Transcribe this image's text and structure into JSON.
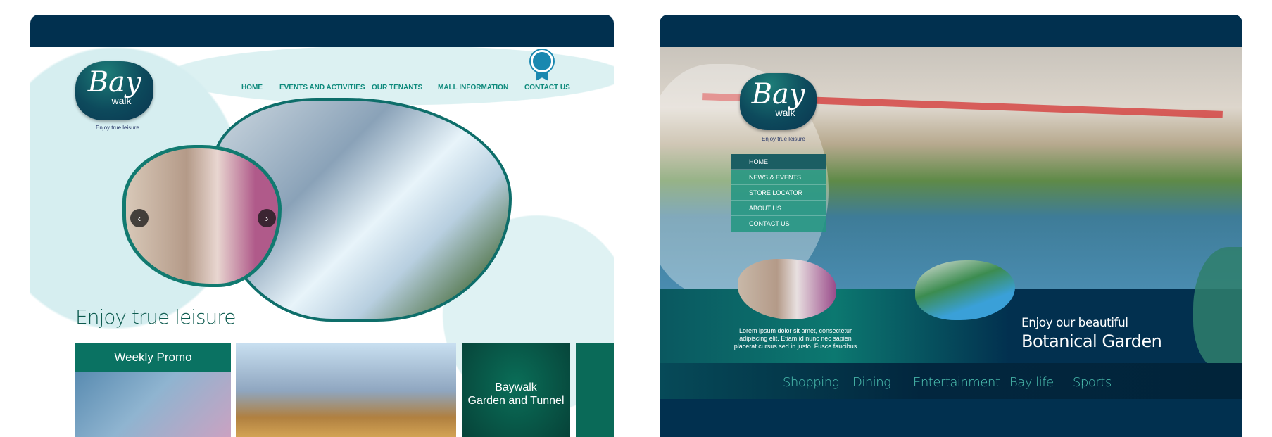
{
  "left_design": {
    "logo": {
      "text": "Bay",
      "subtext": "walk"
    },
    "tagline": "Enjoy true leisure",
    "nav": [
      "HOME",
      "EVENTS  AND  ACTIVITIES",
      "OUR TENANTS",
      "MALL INFORMATION",
      "CONTACT US"
    ],
    "badge_icon": "ribbon-badge-icon",
    "slider": {
      "prev_icon": "chevron-left-icon",
      "next_icon": "chevron-right-icon"
    },
    "heading": "Enjoy true leisure",
    "tiles": {
      "weekly_promo": "Weekly Promo",
      "garden_line1": "Baywalk",
      "garden_line2": "Garden and Tunnel"
    }
  },
  "right_design": {
    "logo": {
      "text": "Bay",
      "subtext": "walk"
    },
    "tagline": "Enjoy true leisure",
    "menu": [
      "HOME",
      "NEWS & EVENTS",
      "STORE LOCATOR",
      "ABOUT US",
      "CONTACT US"
    ],
    "lorem": [
      "Lorem ipsum dolor sit amet, consectetur",
      "adipiscing elit. Etiam id nunc nec sapien",
      "placerat cursus sed in justo. Fusce faucibus"
    ],
    "promo_line1": "Enjoy our beautiful",
    "promo_line2": "Botanical Garden",
    "bottom_nav": [
      "Shopping",
      "Dining",
      "Entertainment",
      "Bay life",
      "Sports"
    ]
  },
  "colors": {
    "navy": "#01304f",
    "teal": "#0e8a7c",
    "nav_teal": "#4fc6b5"
  }
}
